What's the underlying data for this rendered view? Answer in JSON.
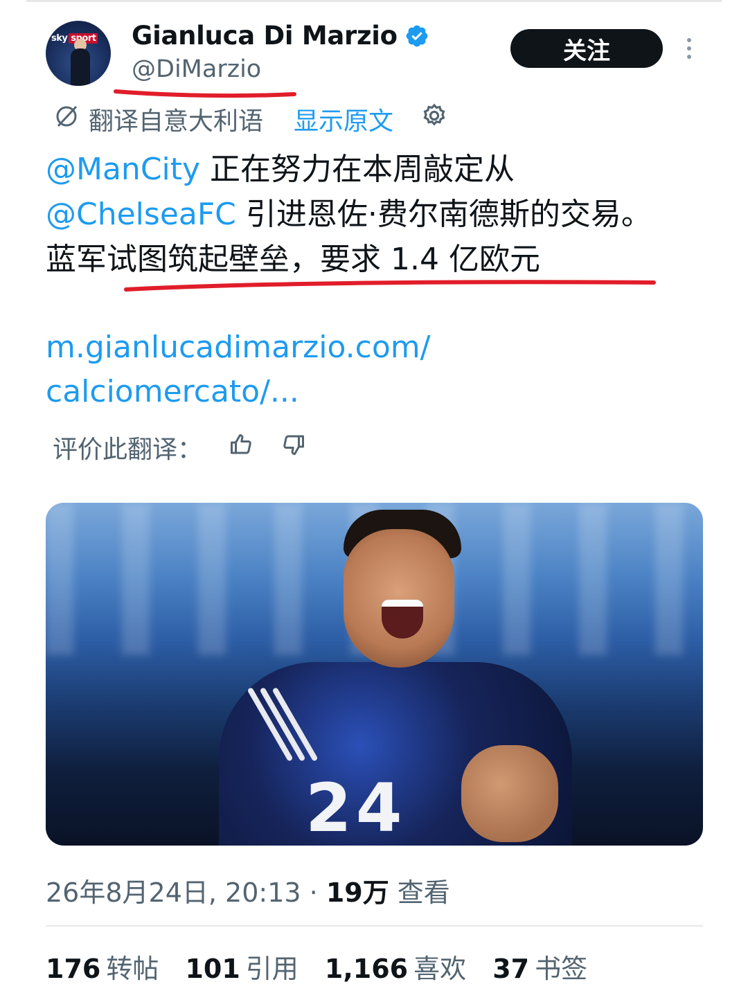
{
  "post": {
    "author_name": "Gianluca Di Marzio",
    "handle": "@DiMarzio",
    "avatar_logo": "sky sport",
    "follow_label": "关注",
    "translate_text": "翻译自意大利语",
    "show_original": "显示原文",
    "body": {
      "mention1": "@ManCity",
      "text1": " 正在努力在本周敲定从 ",
      "mention2": "@ChelseaFC",
      "text2": " 引进恩佐·费尔南德斯的交易。蓝军试图筑起壁垒，要求 1.4 亿欧元"
    },
    "link_line1": "m.gianlucadimarzio.com/",
    "link_line2": "calciomercato/...",
    "rate_label": "评价此翻译："
  },
  "meta": {
    "date": "26年8月24日, 20:13",
    "separator": " · ",
    "views_count": "19万",
    "views_label": " 查看"
  },
  "stats": {
    "reposts_count": "176",
    "reposts_label": "转帖",
    "quotes_count": "101",
    "quotes_label": "引用",
    "likes_count": "1,166",
    "likes_label": "喜欢",
    "bookmarks_count": "37",
    "bookmarks_label": "书签"
  },
  "photo": {
    "jersey_number": "24"
  },
  "icons": {
    "verified": "verified-badge-icon",
    "more": "more-vertical-icon",
    "translate": "translate-icon",
    "settings": "gear-icon",
    "thumb_up": "thumb-up-icon",
    "thumb_down": "thumb-down-icon"
  },
  "colors": {
    "accent": "#1d9bf0",
    "text": "#0f1419",
    "muted": "#536471",
    "annotation": "#e11d2a"
  }
}
